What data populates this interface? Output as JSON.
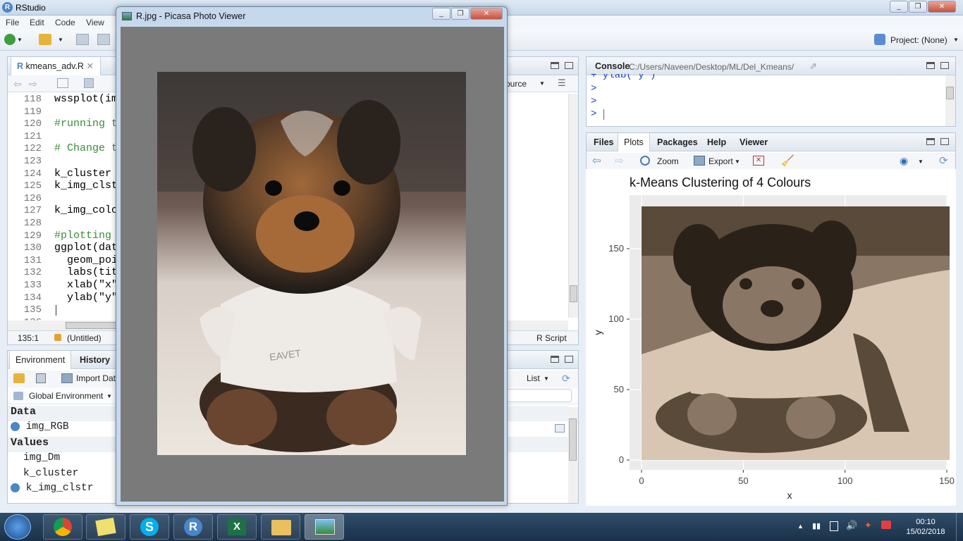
{
  "rstudio": {
    "app_title": "RStudio",
    "menu": [
      "File",
      "Edit",
      "Code",
      "View"
    ],
    "project": "Project: (None)"
  },
  "source": {
    "tab_label": "kmeans_adv.R",
    "source_button": "ource",
    "status_position": "135:1",
    "status_context": "(Untitled)",
    "status_filetype": "R Script",
    "lines": [
      {
        "n": "118",
        "text": "wssplot(im",
        "comment": false
      },
      {
        "n": "119",
        "text": "",
        "comment": false
      },
      {
        "n": "120",
        "text": "#running t",
        "comment": true
      },
      {
        "n": "121",
        "text": "",
        "comment": false
      },
      {
        "n": "122",
        "text": "# Change t",
        "comment": true
      },
      {
        "n": "123",
        "text": "",
        "comment": false
      },
      {
        "n": "124",
        "text": "k_cluster",
        "comment": false
      },
      {
        "n": "125",
        "text": "k_img_clst",
        "comment": false
      },
      {
        "n": "126",
        "text": "",
        "comment": false
      },
      {
        "n": "127",
        "text": "k_img_colo",
        "comment": false
      },
      {
        "n": "128",
        "text": "",
        "comment": false
      },
      {
        "n": "129",
        "text": "#plotting",
        "comment": true
      },
      {
        "n": "130",
        "text": "ggplot(dat",
        "comment": false
      },
      {
        "n": "131",
        "text": "  geom_poi",
        "comment": false
      },
      {
        "n": "132",
        "text": "  labs(tit",
        "comment": false
      },
      {
        "n": "133",
        "text": "  xlab(\"x\"",
        "comment": false
      },
      {
        "n": "134",
        "text": "  ylab(\"y\"",
        "comment": false
      },
      {
        "n": "135",
        "text": "",
        "comment": false
      },
      {
        "n": "136",
        "text": "",
        "comment": false
      }
    ]
  },
  "environment": {
    "tabs": [
      "Environment",
      "History"
    ],
    "import_label": "Import Dat",
    "scope": "Global Environment",
    "view_mode": "List",
    "data_header": "Data",
    "values_header": "Values",
    "data_items": [
      "img_RGB"
    ],
    "value_items": [
      "img_Dm",
      "k_cluster",
      "k_img_clstr"
    ]
  },
  "console": {
    "title": "Console",
    "path": "C:/Users/Naveen/Desktop/ML/Del_Kmeans/",
    "lines": [
      "+   ylab(\"y\")",
      ">",
      ">",
      ">"
    ]
  },
  "viewer": {
    "tabs": [
      "Files",
      "Plots",
      "Packages",
      "Help",
      "Viewer"
    ],
    "active_tab": "Plots",
    "zoom_label": "Zoom",
    "export_label": "Export"
  },
  "picasa": {
    "title": "R.jpg - Picasa Photo Viewer"
  },
  "chart_data": {
    "type": "heatmap",
    "title": "k-Means Clustering of 4 Colours",
    "xlabel": "x",
    "ylabel": "y",
    "xlim": [
      0,
      150
    ],
    "ylim": [
      0,
      180
    ],
    "x_ticks": [
      "0",
      "50",
      "100",
      "150"
    ],
    "y_ticks": [
      "0",
      "50",
      "100",
      "150"
    ],
    "cluster_colors": [
      "#2a2218",
      "#5a4a3a",
      "#8a7664",
      "#d8c6b2"
    ],
    "panel_background": "#ebebeb"
  },
  "taskbar": {
    "time": "00:10",
    "date": "15/02/2018"
  },
  "colors": {
    "rstudio_accent": "#4a86c8",
    "console_prompt": "#1a3cc8",
    "comment_green": "#3c8c3c"
  }
}
